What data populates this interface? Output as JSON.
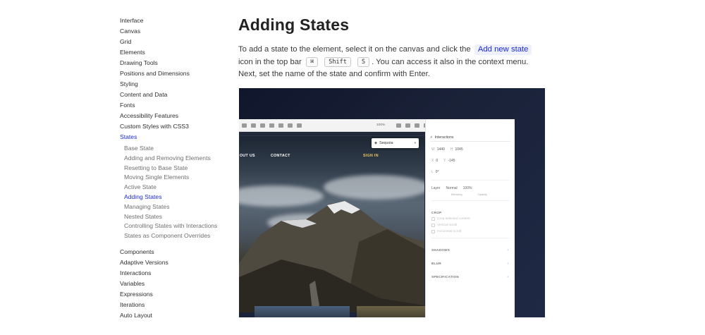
{
  "sidebar": {
    "items_before": [
      {
        "label": "Interface"
      },
      {
        "label": "Canvas"
      },
      {
        "label": "Grid"
      },
      {
        "label": "Elements"
      },
      {
        "label": "Drawing Tools"
      },
      {
        "label": "Positions and Dimensions"
      },
      {
        "label": "Styling"
      },
      {
        "label": "Content and Data"
      },
      {
        "label": "Fonts"
      },
      {
        "label": "Accessibility Features"
      },
      {
        "label": "Custom Styles with CSS3"
      }
    ],
    "active_section": {
      "label": "States"
    },
    "sub_items": [
      {
        "label": "Base State",
        "active": false
      },
      {
        "label": "Adding and Removing Elements",
        "active": false
      },
      {
        "label": "Resetting to Base State",
        "active": false
      },
      {
        "label": "Moving Single Elements",
        "active": false
      },
      {
        "label": "Active State",
        "active": false
      },
      {
        "label": "Adding States",
        "active": true
      },
      {
        "label": "Managing States",
        "active": false
      },
      {
        "label": "Nested States",
        "active": false
      },
      {
        "label": "Controlling States with Interactions",
        "active": false
      },
      {
        "label": "States as Component Overrides",
        "active": false
      }
    ],
    "items_after": [
      {
        "label": "Components"
      },
      {
        "label": "Adaptive Versions"
      },
      {
        "label": "Interactions"
      },
      {
        "label": "Variables"
      },
      {
        "label": "Expressions"
      },
      {
        "label": "Iterations"
      },
      {
        "label": "Auto Layout"
      }
    ]
  },
  "main": {
    "title": "Adding States",
    "para_part1": "To add a state to the element, select it on the canvas and click the",
    "link_label": "Add new state",
    "para_part2": "icon in the top bar",
    "key_cmd": "⌘",
    "key_shift": "Shift",
    "key_s": "S",
    "para_part3": ". You can access it also in the context menu. Next, set the name of the state and confirm with Enter."
  },
  "screenshot": {
    "toolbar_zoom": "100%",
    "nav_about": "OUT US",
    "nav_contact": "CONTACT",
    "nav_signin": "SIGN IN",
    "state_name": "Sequoia",
    "panel": {
      "tab_label": "Interactions",
      "w_label": "W",
      "w_value": "1440",
      "h_label": "H",
      "h_value": "1045",
      "x_label": "X",
      "x_value": "0",
      "y_label": "Y",
      "y_value": "-145",
      "rotation_label": "L",
      "rotation_value": "0°",
      "layer_label": "Layer",
      "blend_value": "Normal",
      "opacity_value": "100%",
      "blending_caption": "Blending",
      "opacity_caption": "Opacity",
      "crop_section": "CROP",
      "crop_options": [
        {
          "label": "Crop selected content"
        },
        {
          "label": "Vertical scroll"
        },
        {
          "label": "Horizontal scroll"
        }
      ],
      "shadows_section": "SHADOWS",
      "blur_section": "BLUR",
      "specification_section": "SPECIFICATION"
    }
  }
}
